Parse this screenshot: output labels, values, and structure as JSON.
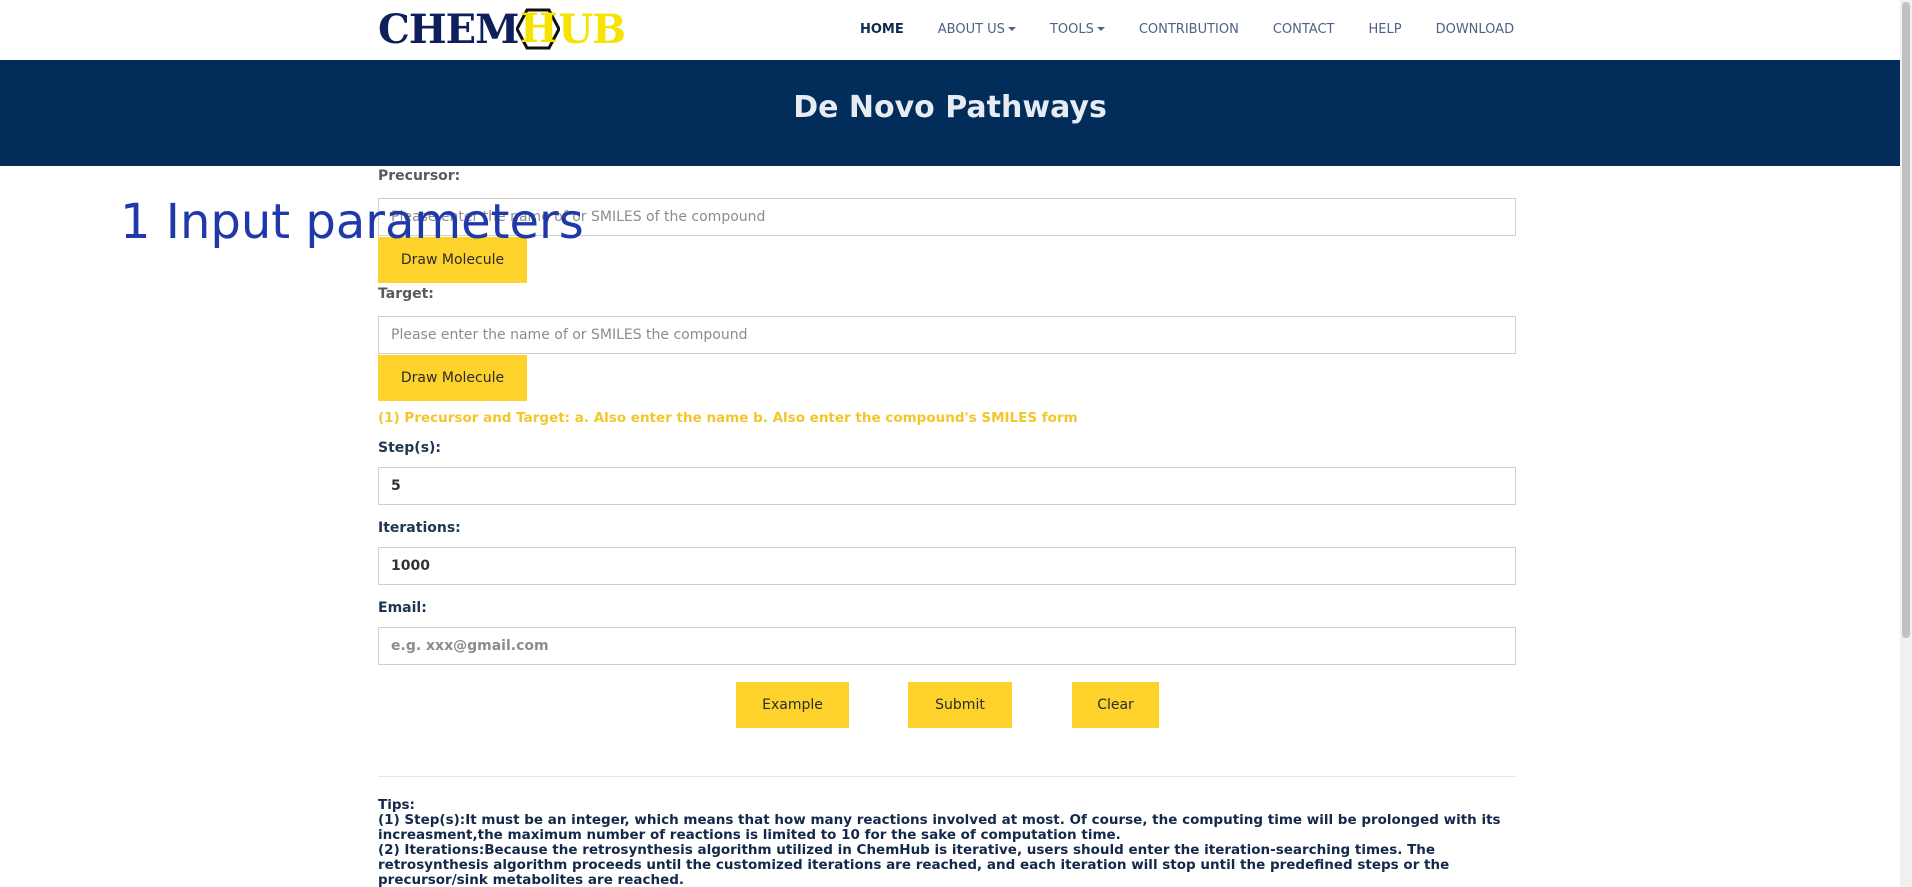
{
  "logo": {
    "part1": "CHEM",
    "hex_letter": "H",
    "part2": "UB"
  },
  "nav": {
    "items": [
      {
        "label": "HOME"
      },
      {
        "label": "ABOUT US"
      },
      {
        "label": "TOOLS"
      },
      {
        "label": "CONTRIBUTION"
      },
      {
        "label": "CONTACT"
      },
      {
        "label": "HELP"
      },
      {
        "label": "DOWNLOAD"
      }
    ]
  },
  "hero": {
    "title": "De Novo Pathways"
  },
  "annotation": {
    "text": "1 Input parameters"
  },
  "form": {
    "precursor": {
      "label": "Precursor:",
      "value": "",
      "placeholder": "Please enter the name of or SMILES of the compound",
      "draw_label": "Draw Molecule"
    },
    "target": {
      "label": "Target:",
      "value": "",
      "placeholder": "Please enter the name of or SMILES the compound",
      "draw_label": "Draw Molecule"
    },
    "hint": "(1) Precursor and Target: a. Also enter the name b. Also enter the compound's SMILES form",
    "steps": {
      "label": "Step(s):",
      "value": "5"
    },
    "iterations": {
      "label": "Iterations:",
      "value": "1000"
    },
    "email": {
      "label": "Email:",
      "value": "",
      "placeholder": "e.g. xxx@gmail.com"
    },
    "buttons": {
      "example": "Example",
      "submit": "Submit",
      "clear": "Clear"
    }
  },
  "tips": {
    "title": "Tips:",
    "items": [
      "(1) Step(s):It must be an integer, which means that how many reactions involved at most. Of course, the computing time will be prolonged with its increasment,the maximum number of reactions is limited to 10 for the sake of computation time.",
      "(2) Iterations:Because the retrosynthesis algorithm utilized in ChemHub is iterative, users should enter the iteration-searching times. The retrosynthesis algorithm proceeds until the customized iterations are reached, and each iteration will stop until the predefined steps or the precursor/sink metabolites are reached."
    ]
  },
  "colors": {
    "hero_bg": "#022d5a",
    "accent_yellow": "#fdd22b",
    "hint_yellow": "#f3c62a",
    "logo_navy": "#0f1f5c",
    "logo_yellow": "#f5e400",
    "annotation_blue": "#1f3aa8"
  }
}
